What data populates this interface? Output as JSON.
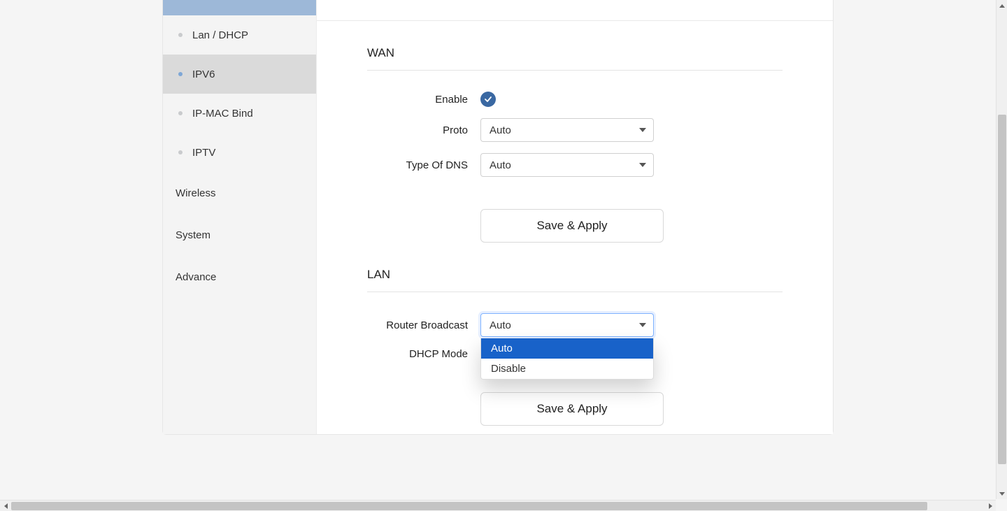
{
  "sidebar": {
    "sub_items": [
      {
        "label": "Lan / DHCP",
        "active": false
      },
      {
        "label": "IPV6",
        "active": true
      },
      {
        "label": "IP-MAC Bind",
        "active": false
      },
      {
        "label": "IPTV",
        "active": false
      }
    ],
    "top_items": [
      {
        "label": "Wireless"
      },
      {
        "label": "System"
      },
      {
        "label": "Advance"
      }
    ]
  },
  "wan": {
    "title": "WAN",
    "enable_label": "Enable",
    "enable_checked": true,
    "proto_label": "Proto",
    "proto_value": "Auto",
    "dns_label": "Type Of DNS",
    "dns_value": "Auto",
    "save_label": "Save & Apply"
  },
  "lan": {
    "title": "LAN",
    "router_broadcast_label": "Router Broadcast",
    "router_broadcast_value": "Auto",
    "router_broadcast_options": [
      "Auto",
      "Disable"
    ],
    "dhcp_mode_label": "DHCP Mode",
    "save_label": "Save & Apply"
  }
}
